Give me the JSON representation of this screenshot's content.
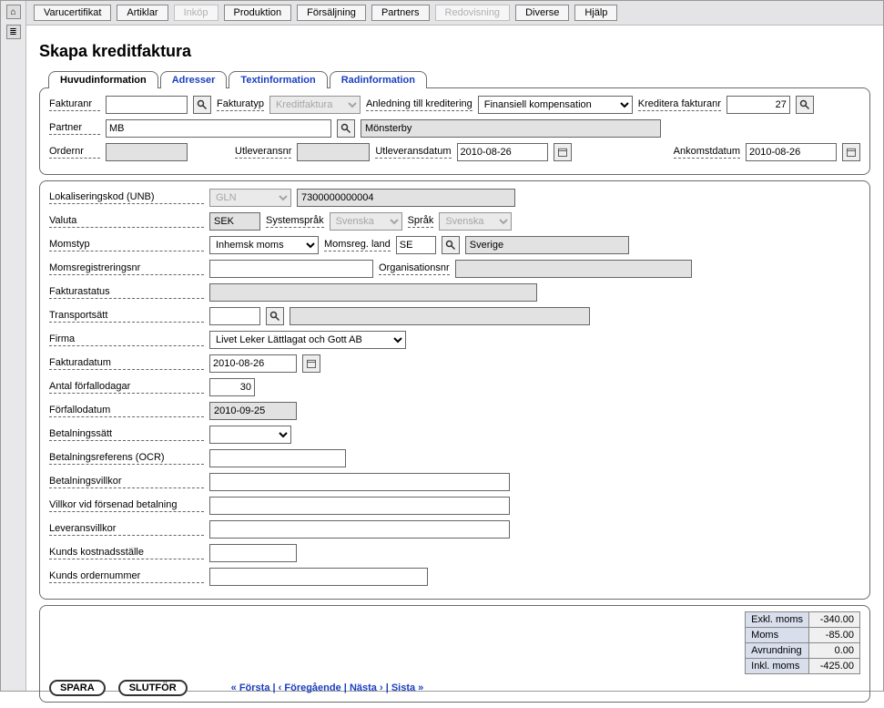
{
  "menu": {
    "items": [
      {
        "label": "Varucertifikat",
        "dim": false
      },
      {
        "label": "Artiklar",
        "dim": false
      },
      {
        "label": "Inköp",
        "dim": true
      },
      {
        "label": "Produktion",
        "dim": false
      },
      {
        "label": "Försäljning",
        "dim": false
      },
      {
        "label": "Partners",
        "dim": false
      },
      {
        "label": "Redovisning",
        "dim": true
      },
      {
        "label": "Diverse",
        "dim": false
      },
      {
        "label": "Hjälp",
        "dim": false
      }
    ]
  },
  "page": {
    "title": "Skapa kreditfaktura"
  },
  "tabs": [
    {
      "label": "Huvudinformation",
      "active": true
    },
    {
      "label": "Adresser",
      "active": false
    },
    {
      "label": "Textinformation",
      "active": false
    },
    {
      "label": "Radinformation",
      "active": false
    }
  ],
  "header": {
    "fakturanr_label": "Fakturanr",
    "fakturanr_value": "",
    "fakturatyp_label": "Fakturatyp",
    "fakturatyp_value": "Kreditfaktura",
    "anledning_label": "Anledning till kreditering",
    "anledning_value": "Finansiell kompensation",
    "kreditera_label": "Kreditera fakturanr",
    "kreditera_value": "27",
    "partner_label": "Partner",
    "partner_code": "MB",
    "partner_name": "Mönsterby",
    "ordernr_label": "Ordernr",
    "ordernr_value": "",
    "utleveransnr_label": "Utleveransnr",
    "utleveransnr_value": "",
    "utleveransdatum_label": "Utleveransdatum",
    "utleveransdatum_value": "2010-08-26",
    "ankomstdatum_label": "Ankomstdatum",
    "ankomstdatum_value": "2010-08-26"
  },
  "details": {
    "lokkod_label": "Lokaliseringskod (UNB)",
    "lokkod_type": "GLN",
    "lokkod_value": "7300000000004",
    "valuta_label": "Valuta",
    "valuta_value": "SEK",
    "systemsprak_label": "Systemspråk",
    "systemsprak_value": "Svenska",
    "sprak_label": "Språk",
    "sprak_value": "Svenska",
    "momstyp_label": "Momstyp",
    "momstyp_value": "Inhemsk moms",
    "momsreg_land_label": "Momsreg. land",
    "momsreg_land_code": "SE",
    "momsreg_land_name": "Sverige",
    "momsregnr_label": "Momsregistreringsnr",
    "momsregnr_value": "",
    "orgnr_label": "Organisationsnr",
    "orgnr_value": "",
    "fakturastatus_label": "Fakturastatus",
    "fakturastatus_value": "",
    "transportsatt_label": "Transportsätt",
    "transportsatt_code": "",
    "transportsatt_name": "",
    "firma_label": "Firma",
    "firma_value": "Livet Leker Lättlagat och Gott AB",
    "fakturadatum_label": "Fakturadatum",
    "fakturadatum_value": "2010-08-26",
    "antal_forfallodagar_label": "Antal förfallodagar",
    "antal_forfallodagar_value": "30",
    "forfallodatum_label": "Förfallodatum",
    "forfallodatum_value": "2010-09-25",
    "betalningssatt_label": "Betalningssätt",
    "betalningssatt_value": "",
    "ocr_label": "Betalningsreferens (OCR)",
    "ocr_value": "",
    "betalningsvillkor_label": "Betalningsvillkor",
    "betalningsvillkor_value": "",
    "forsenad_label": "Villkor vid försenad betalning",
    "forsenad_value": "",
    "leveransvillkor_label": "Leveransvillkor",
    "leveransvillkor_value": "",
    "kostnadsstalle_label": "Kunds kostnadsställe",
    "kostnadsstalle_value": "",
    "kundorder_label": "Kunds ordernummer",
    "kundorder_value": ""
  },
  "totals": {
    "exkl_label": "Exkl. moms",
    "exkl_value": "-340.00",
    "moms_label": "Moms",
    "moms_value": "-85.00",
    "avr_label": "Avrundning",
    "avr_value": "0.00",
    "inkl_label": "Inkl. moms",
    "inkl_value": "-425.00"
  },
  "footer": {
    "save": "SPARA",
    "finish": "SLUTFÖR",
    "first": "« Första",
    "prev": "‹ Föregående",
    "next": "Nästa ›",
    "last": "Sista »",
    "sep": " | "
  }
}
